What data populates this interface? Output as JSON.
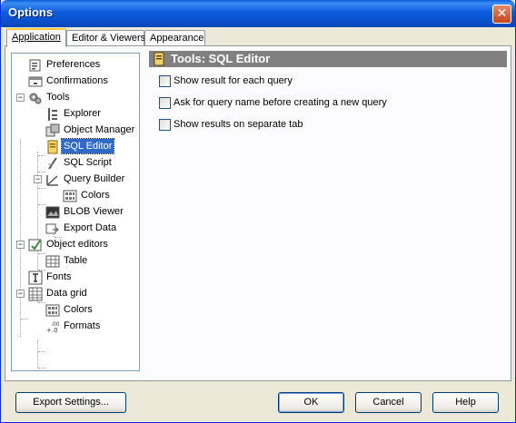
{
  "window": {
    "title": "Options",
    "close_glyph": "✕"
  },
  "tabs": [
    {
      "label": "Application",
      "active": true
    },
    {
      "label": "Editor & Viewers",
      "active": false
    },
    {
      "label": "Appearance",
      "active": false
    }
  ],
  "tree": {
    "items": [
      {
        "label": "Preferences",
        "icon": "preferences-icon",
        "level": 0
      },
      {
        "label": "Confirmations",
        "icon": "confirmations-icon",
        "level": 0
      },
      {
        "label": "Tools",
        "icon": "tools-icon",
        "level": 0,
        "expanded": true
      },
      {
        "label": "Explorer",
        "icon": "explorer-icon",
        "level": 1
      },
      {
        "label": "Object Manager",
        "icon": "object-manager-icon",
        "level": 1
      },
      {
        "label": "SQL Editor",
        "icon": "sql-editor-icon",
        "level": 1,
        "selected": true
      },
      {
        "label": "SQL Script",
        "icon": "sql-script-icon",
        "level": 1
      },
      {
        "label": "Query Builder",
        "icon": "query-builder-icon",
        "level": 1,
        "expanded": true
      },
      {
        "label": "Colors",
        "icon": "colors-icon",
        "level": 2
      },
      {
        "label": "BLOB Viewer",
        "icon": "blob-viewer-icon",
        "level": 1
      },
      {
        "label": "Export Data",
        "icon": "export-data-icon",
        "level": 1
      },
      {
        "label": "Object editors",
        "icon": "object-editors-icon",
        "level": 0,
        "expanded": true
      },
      {
        "label": "Table",
        "icon": "table-icon",
        "level": 1
      },
      {
        "label": "Fonts",
        "icon": "fonts-icon",
        "level": 0
      },
      {
        "label": "Data grid",
        "icon": "data-grid-icon",
        "level": 0,
        "expanded": true
      },
      {
        "label": "Colors",
        "icon": "colors-icon",
        "level": 1
      },
      {
        "label": "Formats",
        "icon": "formats-icon",
        "level": 1
      }
    ]
  },
  "panel": {
    "title": "Tools: SQL Editor",
    "options": [
      {
        "label": "Show result for each query",
        "checked": false
      },
      {
        "label": "Ask for query name before creating a new query",
        "checked": false
      },
      {
        "label": "Show results on separate tab",
        "checked": false
      }
    ]
  },
  "buttons": {
    "export": "Export Settings...",
    "ok": "OK",
    "cancel": "Cancel",
    "help": "Help"
  }
}
